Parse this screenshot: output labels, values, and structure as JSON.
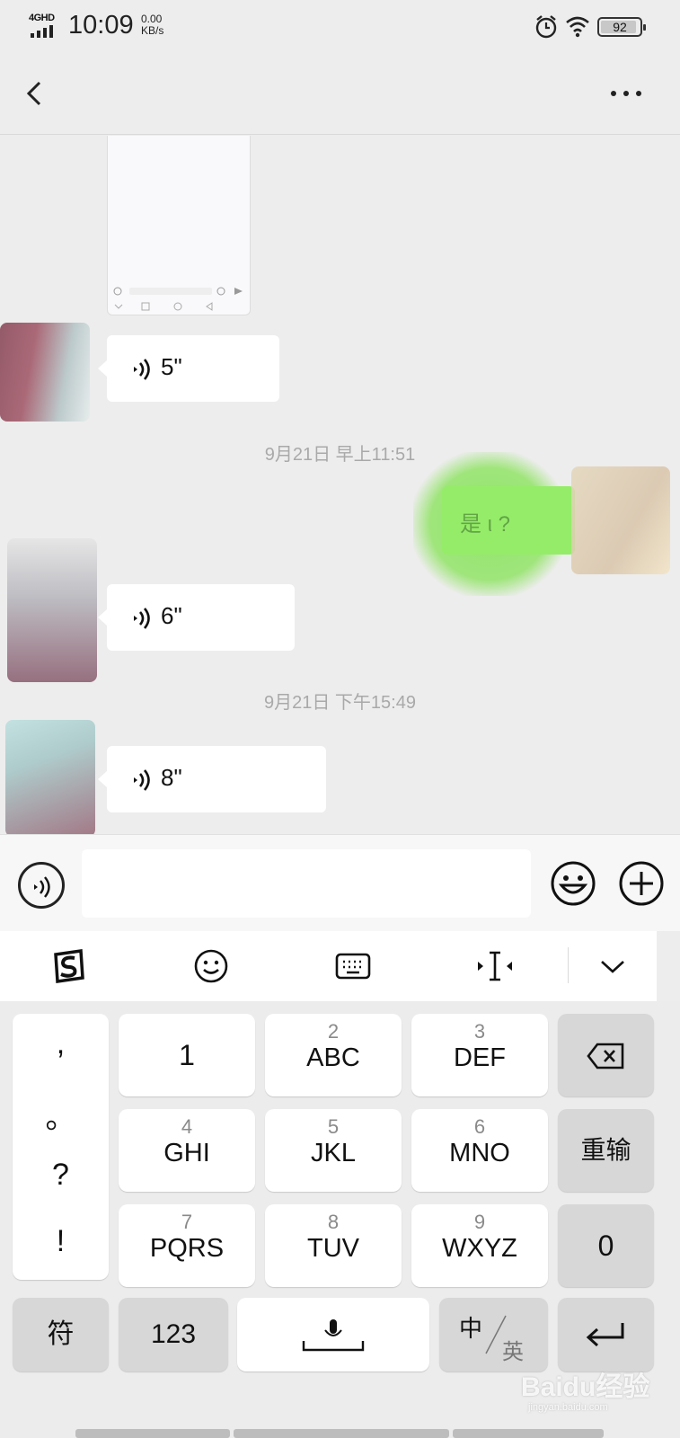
{
  "status_bar": {
    "network": "4GHD",
    "time": "10:09",
    "speed_value": "0.00",
    "speed_unit": "KB/s",
    "battery": "92",
    "battery_level": 0.92,
    "icons": [
      "signal-icon",
      "alarm-icon",
      "wifi-icon",
      "battery-icon"
    ]
  },
  "nav": {
    "back_icon": "back-chevron-icon",
    "more_icon": "more-dots-icon"
  },
  "chat": {
    "messages": [
      {
        "type": "image",
        "side": "received"
      },
      {
        "type": "voice",
        "side": "received",
        "duration": "5\""
      },
      {
        "type": "timestamp",
        "text": "9月21日 早上11:51"
      },
      {
        "type": "text",
        "side": "sent",
        "text": "是 ι  ?"
      },
      {
        "type": "voice",
        "side": "received",
        "duration": "6\""
      },
      {
        "type": "timestamp",
        "text": "9月21日 下午15:49"
      },
      {
        "type": "voice",
        "side": "received",
        "duration": "8\""
      }
    ]
  },
  "input_bar": {
    "voice_icon": "voice-toggle-icon",
    "emoji_icon": "emoji-icon",
    "plus_icon": "plus-icon"
  },
  "keyboard_toolbar": {
    "icons": [
      "sogou-logo-icon",
      "emoji-face-icon",
      "keyboard-icon",
      "cursor-move-icon",
      "collapse-chevron-icon"
    ]
  },
  "keyboard": {
    "punctuation": [
      ",",
      "。",
      "?",
      "!"
    ],
    "keys": [
      {
        "num": "",
        "letters": "1"
      },
      {
        "num": "2",
        "letters": "ABC"
      },
      {
        "num": "3",
        "letters": "DEF"
      },
      {
        "num": "4",
        "letters": "GHI"
      },
      {
        "num": "5",
        "letters": "JKL"
      },
      {
        "num": "6",
        "letters": "MNO"
      },
      {
        "num": "7",
        "letters": "PQRS"
      },
      {
        "num": "8",
        "letters": "TUV"
      },
      {
        "num": "9",
        "letters": "WXYZ"
      }
    ],
    "side_keys": {
      "reenter": "重输",
      "zero": "0"
    },
    "bottom_row": {
      "symbols": "符",
      "numbers": "123",
      "lang_cn": "中",
      "lang_en": "英"
    }
  },
  "watermark": {
    "text": "Baidu经验",
    "url": "jingyan.baidu.com"
  }
}
